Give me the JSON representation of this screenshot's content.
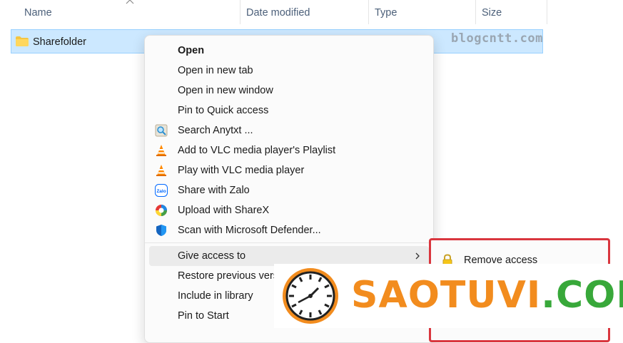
{
  "columns": {
    "name": "Name",
    "date_modified": "Date modified",
    "type": "Type",
    "size": "Size"
  },
  "file": {
    "name": "Sharefolder"
  },
  "watermark_top": "blogcntt.com",
  "context_menu": {
    "items": [
      {
        "label": "Open",
        "icon": ""
      },
      {
        "label": "Open in new tab",
        "icon": ""
      },
      {
        "label": "Open in new window",
        "icon": ""
      },
      {
        "label": "Pin to Quick access",
        "icon": ""
      },
      {
        "label": "Search Anytxt ...",
        "icon": "anytxt-search-icon"
      },
      {
        "label": "Add to VLC media player's Playlist",
        "icon": "vlc-icon"
      },
      {
        "label": "Play with VLC media player",
        "icon": "vlc-icon"
      },
      {
        "label": "Share with Zalo",
        "icon": "zalo-icon"
      },
      {
        "label": "Upload with ShareX",
        "icon": "sharex-icon"
      },
      {
        "label": "Scan with Microsoft Defender...",
        "icon": "defender-shield-icon"
      },
      {
        "label": "Give access to",
        "icon": "",
        "has_submenu": true
      },
      {
        "label": "Restore previous vers",
        "icon": ""
      },
      {
        "label": "Include in library",
        "icon": ""
      },
      {
        "label": "Pin to Start",
        "icon": ""
      }
    ]
  },
  "submenu": {
    "items": [
      {
        "label": "Remove access",
        "icon": "lock-icon"
      }
    ]
  },
  "banner": {
    "part1": "SAOTU",
    "part2": "VI",
    "part3": ".COM"
  },
  "colors": {
    "selection": "#cce8ff",
    "submenu_border": "#d9363e",
    "banner_orange": "#f28c1e",
    "banner_green": "#38a83a"
  }
}
